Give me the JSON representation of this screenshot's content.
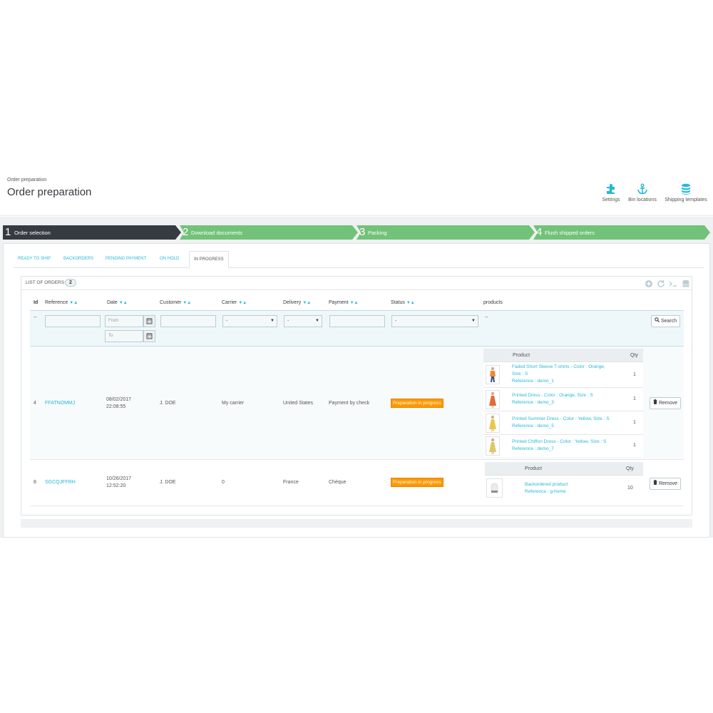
{
  "header": {
    "breadcrumb": "Order preparation",
    "title": "Order preparation",
    "toolbar": {
      "settings": "Settings",
      "bin_locations": "Bin locations",
      "shipping_templates": "Shipping templates"
    }
  },
  "steps": [
    {
      "num": "1",
      "label": "Order selection",
      "color": "#363a41"
    },
    {
      "num": "2",
      "label": "Download documents",
      "color": "#72c279"
    },
    {
      "num": "3",
      "label": "Packing",
      "color": "#72c279"
    },
    {
      "num": "4",
      "label": "Flush shipped orders",
      "color": "#72c279"
    }
  ],
  "tabs": [
    "Ready to ship",
    "Backorders",
    "Pending payment",
    "On hold",
    "In progress"
  ],
  "active_tab": "In progress",
  "list": {
    "title": "List of orders",
    "count": "2",
    "columns": {
      "id": "Id",
      "reference": "Reference",
      "date": "Date",
      "customer": "Customer",
      "carrier": "Carrier",
      "delivery": "Delivery",
      "payment": "Payment",
      "status": "Status",
      "products": "products"
    },
    "sort_arrows": "▼▲",
    "filters": {
      "id": "--",
      "date_from_placeholder": "From",
      "date_to_placeholder": "To",
      "carrier_value": "-",
      "delivery_value": "-",
      "status_value": "-",
      "products": "--",
      "search_label": "Search"
    },
    "product_headers": {
      "product": "Product",
      "qty": "Qty"
    },
    "remove_label": "Remove",
    "orders": [
      {
        "id": "4",
        "reference": "FFATNOMMJ",
        "date": "08/02/2017",
        "time": "22:08:55",
        "customer": "J. DOE",
        "carrier": "My carrier",
        "delivery": "United States",
        "payment": "Payment by check",
        "status": "Preparation in progress",
        "products": [
          {
            "name": "Faded Short Sleeve T-shirts - Color : Orange,",
            "name2": "Size : S",
            "ref": "Reference : demo_1",
            "qty": "1"
          },
          {
            "name": "Printed Dress - Color : Orange, Size : S",
            "name2": "",
            "ref": "Reference : demo_3",
            "qty": "1"
          },
          {
            "name": "Printed Summer Dress - Color : Yellow, Size : S",
            "name2": "",
            "ref": "Reference : demo_5",
            "qty": "1"
          },
          {
            "name": "Printed Chiffon Dress - Color : Yellow, Size : S",
            "name2": "",
            "ref": "Reference : demo_7",
            "qty": "1"
          }
        ]
      },
      {
        "id": "8",
        "reference": "SGCQJFFRH",
        "date": "10/26/2017",
        "time": "12:52:20",
        "customer": "J. DOE",
        "carrier": "0",
        "delivery": "France",
        "payment": "Chèque",
        "status": "Preparation in progress",
        "products": [
          {
            "name": "Backordered product",
            "name2": "",
            "ref": "Reference : g-home",
            "qty": "10"
          }
        ]
      }
    ]
  },
  "colors": {
    "accent": "#25b9d7",
    "step_active": "#363a41",
    "step_done": "#72c279",
    "status": "#ff9800"
  }
}
